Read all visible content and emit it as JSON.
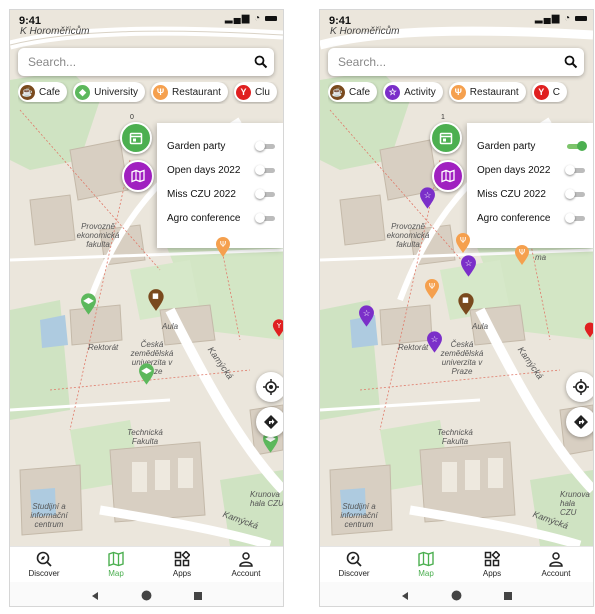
{
  "status": {
    "time": "9:41"
  },
  "map_labels": {
    "street_top": "K Horoměřicům",
    "faculty": "Provozně ekonomická fakulta",
    "rectorate": "Rektorát",
    "university": "Česká zemědělská univerzita v Praze",
    "aula": "Aula",
    "technical": "Technická Fakulta",
    "kamycka": "Kamýcká",
    "study": "Studijní a informační centrum",
    "krunova": "Krunova hala CZU",
    "ma": "ma"
  },
  "screens": [
    {
      "search_placeholder": "Search...",
      "chips": [
        {
          "label": "Cafe",
          "icon": "coffee-cup-icon",
          "color": "#7a4a1e"
        },
        {
          "label": "University",
          "icon": "graduation-cap-icon",
          "color": "#5cb85c"
        },
        {
          "label": "Restaurant",
          "icon": "fork-knife-icon",
          "color": "#f5a04e"
        },
        {
          "label": "Clu",
          "icon": "cocktail-icon",
          "color": "#e02020"
        }
      ],
      "events": [
        {
          "label": "Garden party",
          "on": false
        },
        {
          "label": "Open days 2022",
          "on": false
        },
        {
          "label": "Miss CZU 2022",
          "on": false
        },
        {
          "label": "Agro conference",
          "on": false
        }
      ],
      "calendar_badge": "0"
    },
    {
      "search_placeholder": "Search...",
      "chips": [
        {
          "label": "Cafe",
          "icon": "coffee-cup-icon",
          "color": "#7a4a1e"
        },
        {
          "label": "Activity",
          "icon": "star-icon",
          "color": "#7b2fc9"
        },
        {
          "label": "Restaurant",
          "icon": "fork-knife-icon",
          "color": "#f5a04e"
        },
        {
          "label": "C",
          "icon": "cocktail-icon",
          "color": "#e02020"
        }
      ],
      "events": [
        {
          "label": "Garden party",
          "on": true
        },
        {
          "label": "Open days 2022",
          "on": false
        },
        {
          "label": "Miss CZU 2022",
          "on": false
        },
        {
          "label": "Agro conference",
          "on": false
        }
      ],
      "calendar_badge": "1"
    }
  ],
  "nav": [
    {
      "label": "Discover",
      "icon": "discover-icon"
    },
    {
      "label": "Map",
      "icon": "map-icon",
      "active": true
    },
    {
      "label": "Apps",
      "icon": "apps-icon"
    },
    {
      "label": "Account",
      "icon": "account-icon"
    }
  ],
  "colors": {
    "accent": "#4caf50",
    "cafe": "#7a4a1e",
    "university": "#5cb85c",
    "restaurant": "#f5a04e",
    "club": "#e02020",
    "activity": "#7b2fc9",
    "calendar_button": "#4caf50",
    "map_button": "#a020c0"
  }
}
